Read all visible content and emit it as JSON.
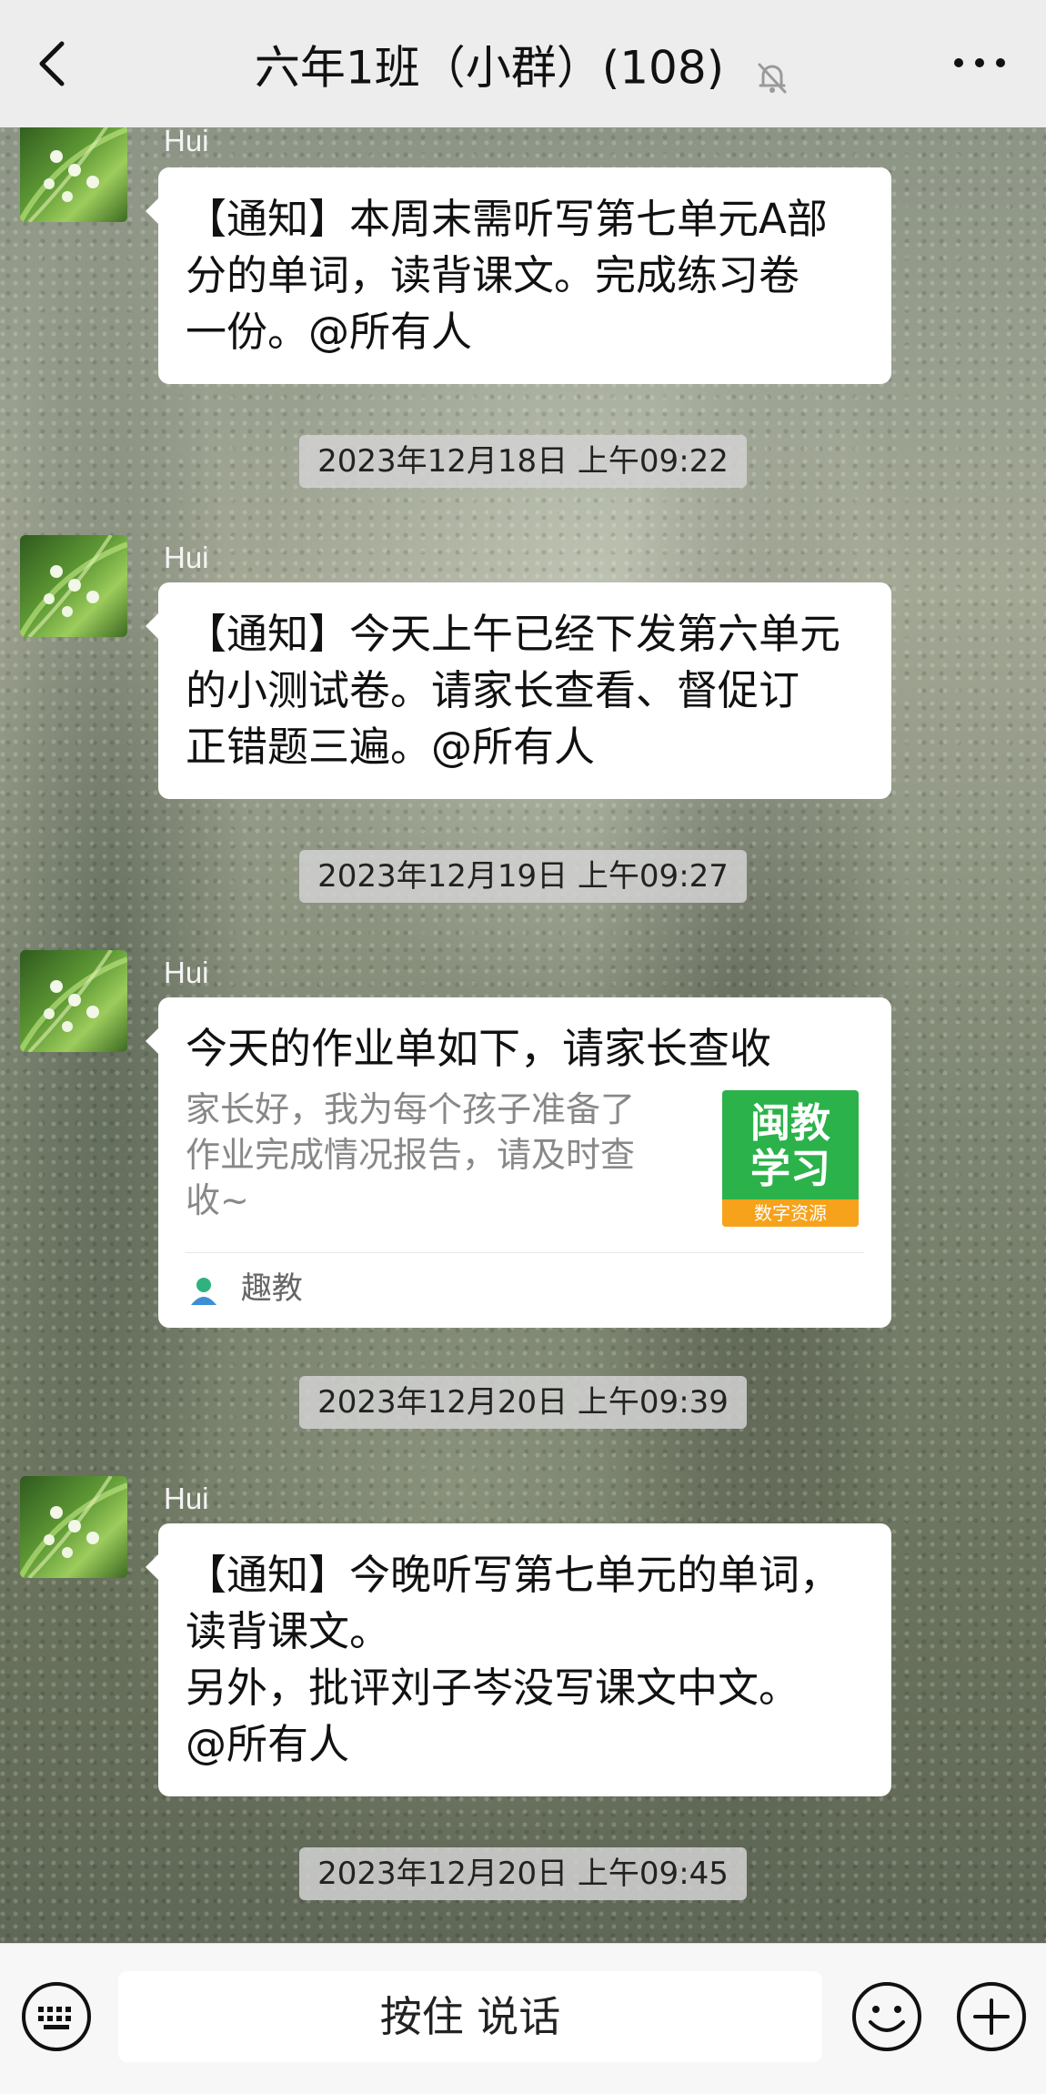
{
  "header": {
    "title": "六年1班（小群）(108)",
    "icons": {
      "back": "chevron-left-icon",
      "mute": "bell-off-icon",
      "more": "more-dots-icon"
    }
  },
  "messages": [
    {
      "sender": "Hui",
      "lines": [
        "【通知】本周末需听写第七单元A部",
        "分的单词，读背课文。完成练习卷",
        "一份。@所有人"
      ],
      "time": "2023年12月18日 上午09:22"
    },
    {
      "sender": "Hui",
      "lines": [
        "【通知】今天上午已经下发第六单元",
        "的小测试卷。请家长查看、督促订",
        "正错题三遍。@所有人"
      ],
      "time": "2023年12月19日 上午09:27"
    },
    {
      "sender": "Hui",
      "card": {
        "title": "今天的作业单如下，请家长查收",
        "desc_lines": [
          "家长好，我为每个孩子准备了",
          "作业完成情况报告，请及时查",
          "收~"
        ],
        "thumb_line1": "闽教",
        "thumb_line2": "学习",
        "thumb_sub": "数字资源",
        "source": "趣教"
      },
      "time": "2023年12月20日 上午09:39"
    },
    {
      "sender": "Hui",
      "lines": [
        "【通知】今晚听写第七单元的单词，",
        "读背课文。",
        "另外，批评刘子岑没写课文中文。",
        "@所有人"
      ],
      "time": "2023年12月20日 上午09:45"
    }
  ],
  "input_bar": {
    "voice_label": "按住 说话",
    "icons": {
      "keyboard": "keyboard-icon",
      "emoji": "emoji-icon",
      "plus": "plus-icon"
    }
  },
  "colors": {
    "header_bg": "#ededed",
    "bubble_bg": "#ffffff",
    "thumb_green": "#2bb24a",
    "thumb_orange": "#f7a21b"
  }
}
